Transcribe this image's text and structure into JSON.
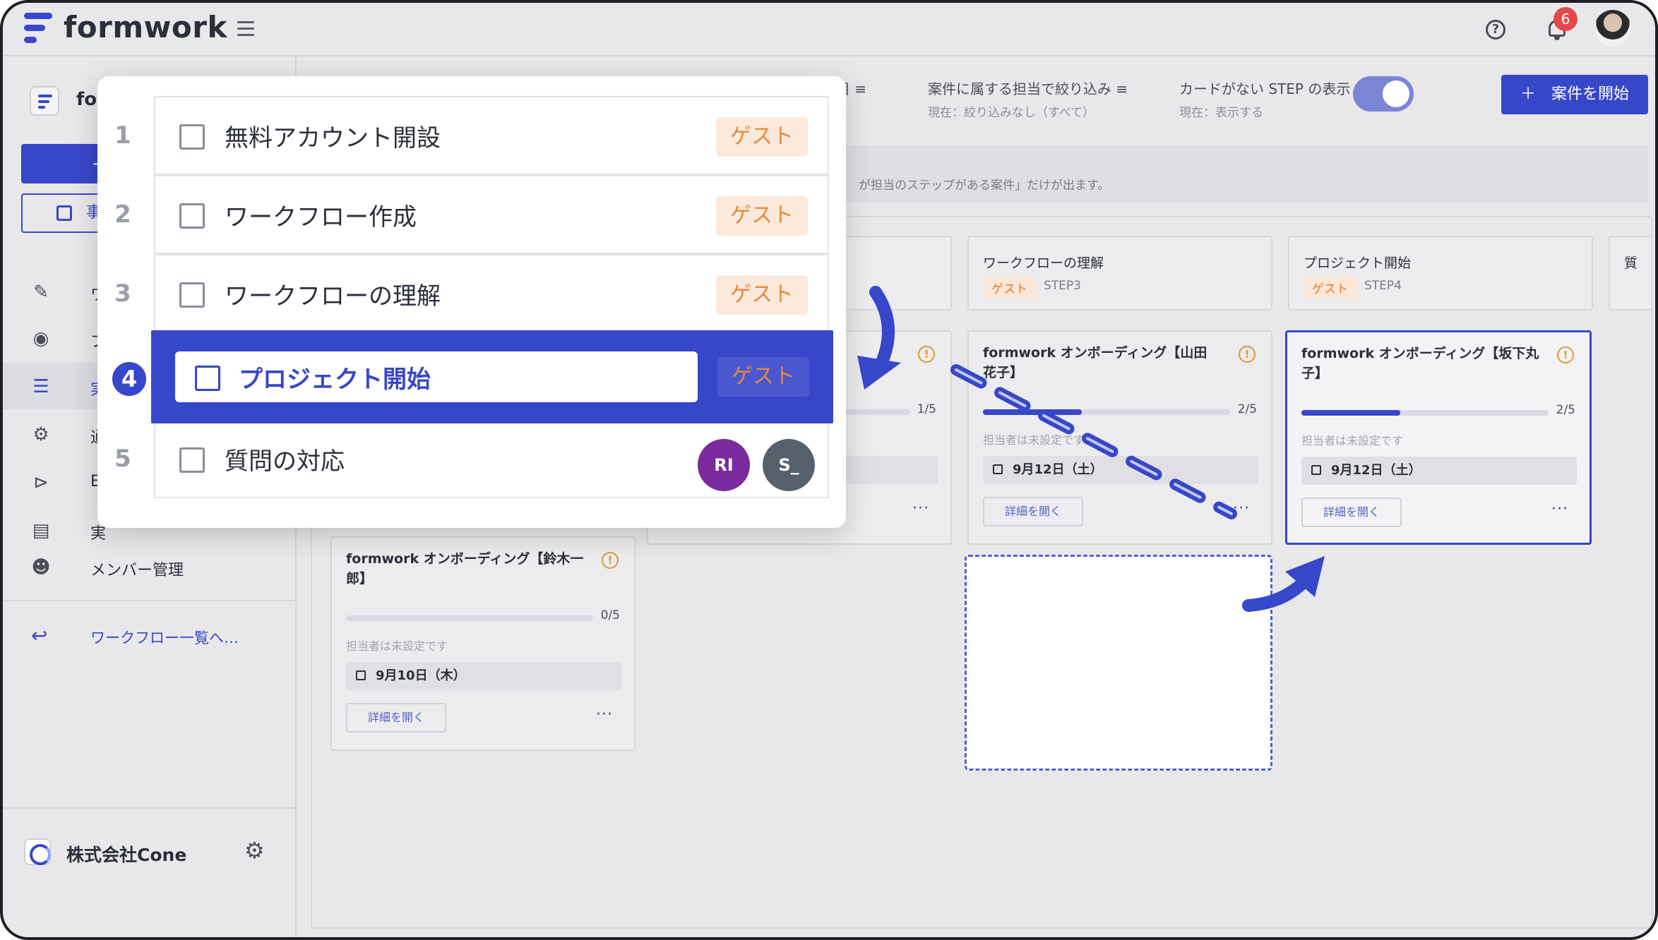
{
  "app": {
    "brand": "formwork",
    "notifications_count": "6"
  },
  "sidebar": {
    "title": "for",
    "primary_button": "+",
    "secondary_button": "事",
    "items": [
      {
        "icon": "pencil-icon",
        "label": "ワ"
      },
      {
        "icon": "eye-icon",
        "label": "プ"
      },
      {
        "icon": "checklist-icon",
        "label": "実"
      },
      {
        "icon": "gear-icon",
        "label": "通"
      },
      {
        "icon": "play-icon",
        "label": "E"
      },
      {
        "icon": "document-search-icon",
        "label": "実"
      },
      {
        "icon": "people-icon",
        "label": "メンバー管理"
      }
    ],
    "back_link": "ワークフロー一覧へ…",
    "org_name": "株式会社Cone"
  },
  "filters": [
    {
      "label": "目",
      "sub": ""
    },
    {
      "label": "案件に属する担当で絞り込み",
      "sub": "現在：絞り込みなし（すべて）"
    },
    {
      "label": "カードがない STEP の表示",
      "sub": "現在：表示する"
    }
  ],
  "start_button": "案件を開始",
  "notice_text": "が担当のステップがある案件」だけが出ます。",
  "columns": [
    {
      "title": "ワークフローの理解",
      "tag": "ゲスト",
      "step": "STEP3"
    },
    {
      "title": "プロジェクト開始",
      "tag": "ゲスト",
      "step": "STEP4"
    },
    {
      "title": "質",
      "tag": "",
      "step": ""
    }
  ],
  "cards": [
    {
      "title": "formwork オンボーディング【鈴木一郎】",
      "progress": 0.0,
      "fraction": "0/5",
      "assignee": "担当者は未設定です",
      "date": "9月10日（木）",
      "open": "詳細を開く"
    },
    {
      "title": "",
      "progress": 0.2,
      "fraction": "1/5",
      "assignee": "",
      "date": "",
      "open": ""
    },
    {
      "title": "formwork オンボーディング【山田 花子】",
      "progress": 0.4,
      "fraction": "2/5",
      "assignee": "担当者は未設定です",
      "date": "9月12日（土）",
      "open": "詳細を開く"
    },
    {
      "title": "formwork オンボーディング【坂下丸子】",
      "progress": 0.4,
      "fraction": "2/5",
      "assignee": "担当者は未設定です",
      "date": "9月12日（土）",
      "open": "詳細を開く"
    }
  ],
  "steps_panel": [
    {
      "num": "1",
      "label": "無料アカウント開設",
      "tag": "ゲスト"
    },
    {
      "num": "2",
      "label": "ワークフロー作成",
      "tag": "ゲスト"
    },
    {
      "num": "3",
      "label": "ワークフローの理解",
      "tag": "ゲスト"
    },
    {
      "num": "4",
      "label": "プロジェクト開始",
      "tag": "ゲスト"
    },
    {
      "num": "5",
      "label": "質問の対応",
      "tag": ""
    }
  ],
  "step5_avatars": [
    {
      "initials": "RI",
      "color": "#7b2a9e"
    },
    {
      "initials": "S_",
      "color": "#56606b"
    }
  ],
  "colors": {
    "accent": "#3747c9",
    "guest_tag_bg": "#fbe9dc",
    "guest_tag_text": "#e5893b",
    "warn": "#e0982e"
  }
}
